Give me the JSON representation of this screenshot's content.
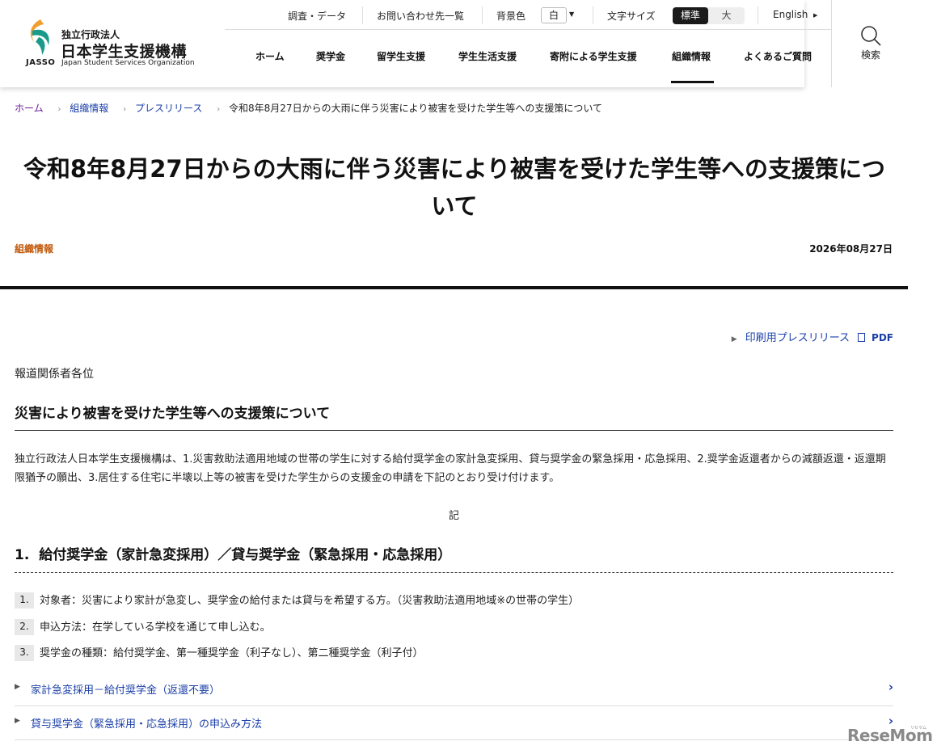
{
  "header": {
    "logo": {
      "jasso": "JASSO",
      "org_small": "独立行政法人",
      "org_main": "日本学生支援機構",
      "org_en": "Japan Student Services Organization"
    },
    "utility": {
      "research": "調査・データ",
      "contacts": "お問い合わせ先一覧",
      "bg_label": "背景色",
      "bg_value": "白",
      "font_size_label": "文字サイズ",
      "font_std": "標準",
      "font_large": "大",
      "english": "English"
    },
    "nav": [
      "ホーム",
      "奨学金",
      "留学生支援",
      "学生生活支援",
      "寄附による学生支援",
      "組織情報",
      "よくあるご質問"
    ],
    "nav_active": "組織情報",
    "search_label": "検索"
  },
  "breadcrumb": {
    "home": "ホーム",
    "items": [
      "組織情報",
      "プレスリリース"
    ],
    "current": "令和8年8月27日からの大雨に伴う災害により被害を受けた学生等への支援策について"
  },
  "article": {
    "title": "令和8年8月27日からの大雨に伴う災害により被害を受けた学生等への支援策について",
    "category": "組織情報",
    "date": "2026年08月27日",
    "print_link": "印刷用プレスリリース",
    "pdf_label": "PDF",
    "addressee": "報道関係者各位",
    "subtitle": "災害により被害を受けた学生等への支援策について",
    "intro": "独立行政法人日本学生支援機構は、1.災害救助法適用地域の世帯の学生に対する給付奨学金の家計急変採用、貸与奨学金の緊急採用・応急採用、2.奨学金返還者からの減額返還・返還期限猶予の願出、3.居住する住宅に半壊以上等の被害を受けた学生からの支援金の申請を下記のとおり受け付けます。",
    "ki": "記",
    "section1": {
      "num": "1.",
      "heading": "給付奨学金（家計急変採用）／貸与奨学金（緊急採用・応急採用）",
      "items": [
        {
          "num": "1.",
          "text": "対象者：災害により家計が急変し、奨学金の給付または貸与を希望する方。（災害救助法適用地域※の世帯の学生）"
        },
        {
          "num": "2.",
          "text": "申込方法：在学している学校を通じて申し込む。"
        },
        {
          "num": "3.",
          "text": "奨学金の種類：給付奨学金、第一種奨学金（利子なし）、第二種奨学金（利子付）"
        }
      ],
      "links": [
        "家計急変採用－給付奨学金（返還不要）",
        "貸与奨学金（緊急採用・応急採用）の申込み方法"
      ]
    }
  },
  "watermark": "ReseMom",
  "watermark_sub": "リセマム",
  "colors": {
    "link": "#1a3fa8",
    "category": "#c0580a",
    "logo_orange": "#f0a030",
    "logo_teal": "#1a9a8a"
  }
}
